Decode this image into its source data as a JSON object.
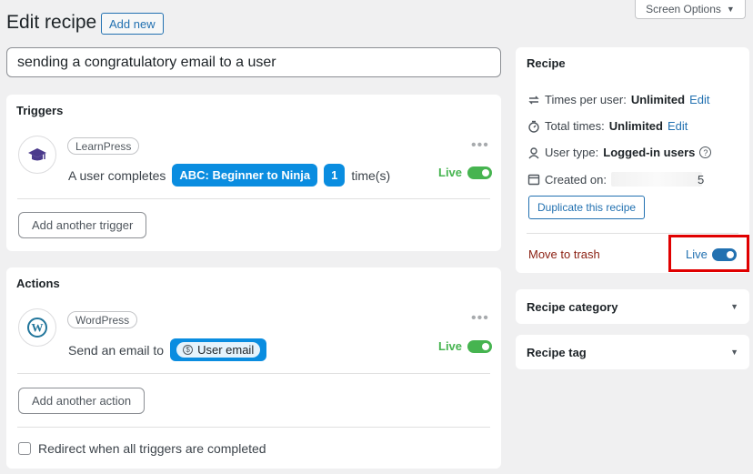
{
  "header": {
    "screen_options": "Screen Options",
    "title": "Edit recipe",
    "add_new": "Add new"
  },
  "recipe_title_value": "sending a congratulatory email to a user",
  "triggers": {
    "title": "Triggers",
    "integration": "LearnPress",
    "sentence_prefix": "A user completes",
    "course_token": "ABC: Beginner to Ninja",
    "count_token": "1",
    "sentence_suffix": "time(s)",
    "status": "Live",
    "add_button": "Add another trigger"
  },
  "actions": {
    "title": "Actions",
    "integration": "WordPress",
    "sentence_prefix": "Send an email to",
    "recipient_token": "User email",
    "status": "Live",
    "add_button": "Add another action",
    "redirect_label": "Redirect when all triggers are completed"
  },
  "sidebar": {
    "title": "Recipe",
    "times_per_user_label": "Times per user:",
    "times_per_user_value": "Unlimited",
    "total_times_label": "Total times:",
    "total_times_value": "Unlimited",
    "edit_link": "Edit",
    "user_type_label": "User type:",
    "user_type_value": "Logged-in users",
    "created_on_label": "Created on:",
    "created_on_visible_fragment": "5",
    "duplicate_button": "Duplicate this recipe",
    "trash_link": "Move to trash",
    "status": "Live",
    "category_title": "Recipe category",
    "tag_title": "Recipe tag"
  },
  "colors": {
    "accent": "#2271b1",
    "token": "#0a8de0",
    "live_green": "#46b450",
    "trash": "#8a1f11",
    "highlight": "#e00000"
  }
}
